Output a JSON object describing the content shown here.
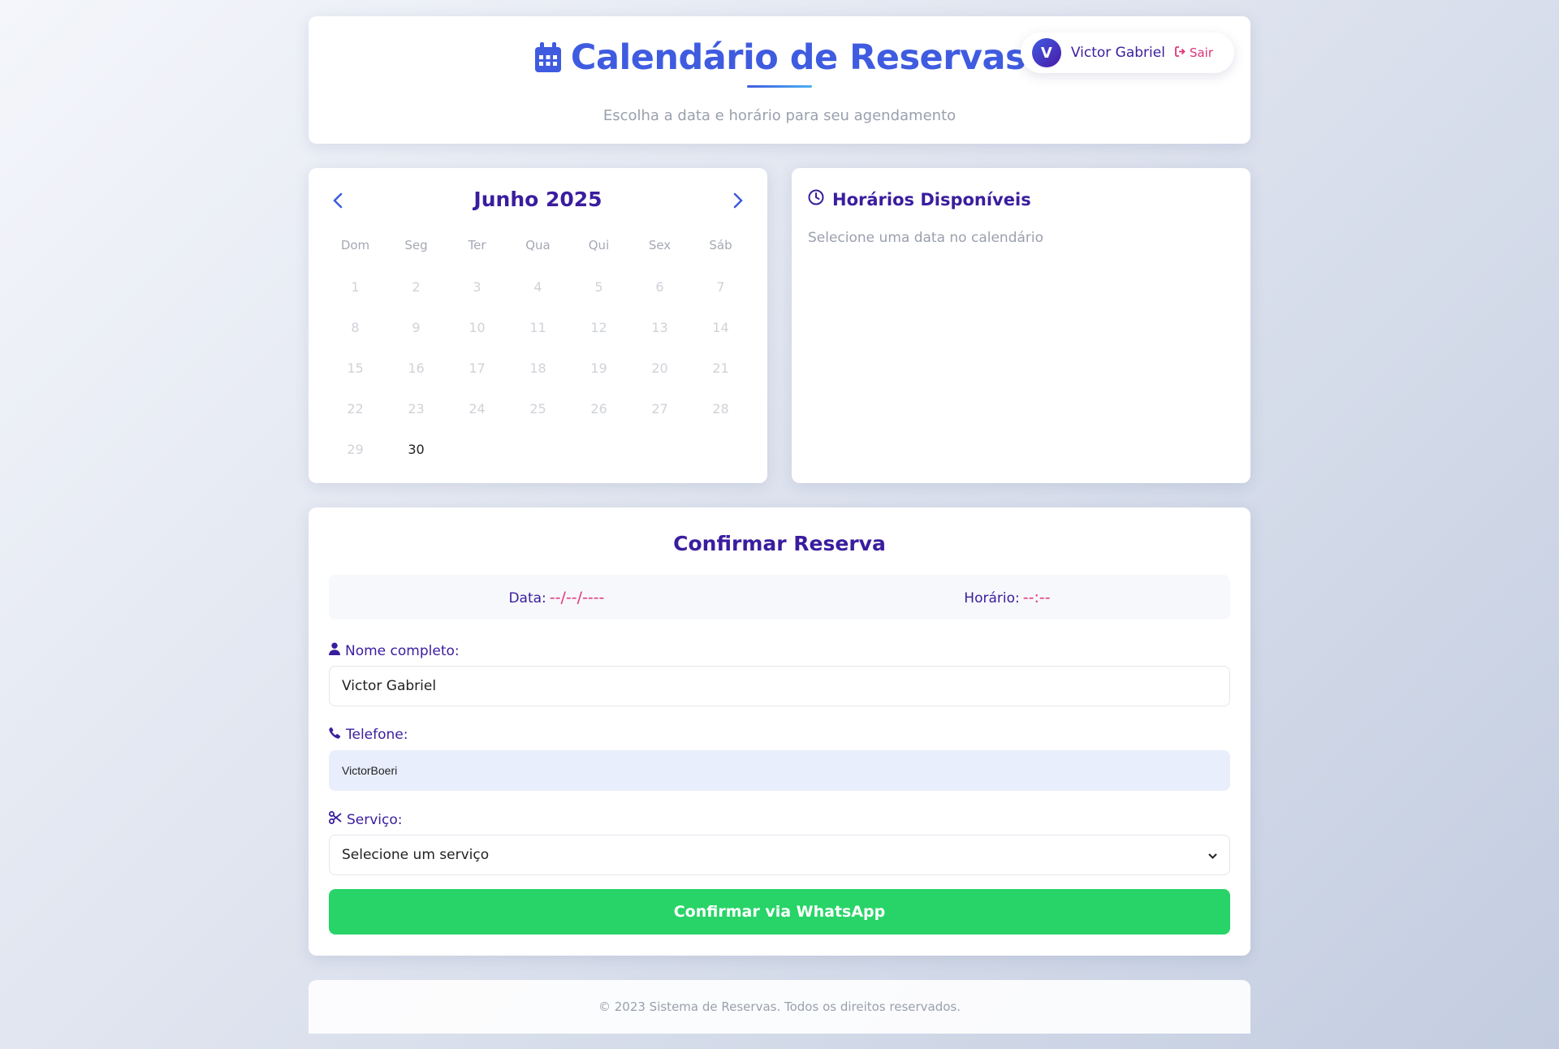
{
  "header": {
    "title": "Calendário de Reservas",
    "subtitle": "Escolha a data e horário para seu agendamento",
    "user": {
      "initial": "V",
      "name": "Victor Gabriel",
      "logout_label": "Sair"
    }
  },
  "calendar": {
    "month_label": "Junho 2025",
    "weekdays": [
      "Dom",
      "Seg",
      "Ter",
      "Qua",
      "Qui",
      "Sex",
      "Sáb"
    ],
    "days": [
      "1",
      "2",
      "3",
      "4",
      "5",
      "6",
      "7",
      "8",
      "9",
      "10",
      "11",
      "12",
      "13",
      "14",
      "15",
      "16",
      "17",
      "18",
      "19",
      "20",
      "21",
      "22",
      "23",
      "24",
      "25",
      "26",
      "27",
      "28",
      "29",
      "30"
    ],
    "enabled_days": [
      "30"
    ]
  },
  "slots": {
    "title": "Horários Disponíveis",
    "empty_message": "Selecione uma data no calendário"
  },
  "booking": {
    "title": "Confirmar Reserva",
    "date_label": "Data:",
    "date_value": "--/--/----",
    "time_label": "Horário:",
    "time_value": "--:--",
    "name_label": "Nome completo:",
    "name_value": "Victor Gabriel",
    "phone_label": "Telefone:",
    "phone_value": "VictorBoeri",
    "service_label": "Serviço:",
    "service_selected": "Selecione um serviço",
    "submit_label": "Confirmar via WhatsApp"
  },
  "footer": {
    "text": "© 2023 Sistema de Reservas. Todos os direitos reservados."
  },
  "colors": {
    "accent": "#3f5be0",
    "title_purple": "#3a1d9e",
    "pink": "#e0347a",
    "whatsapp_green": "#28d468"
  }
}
